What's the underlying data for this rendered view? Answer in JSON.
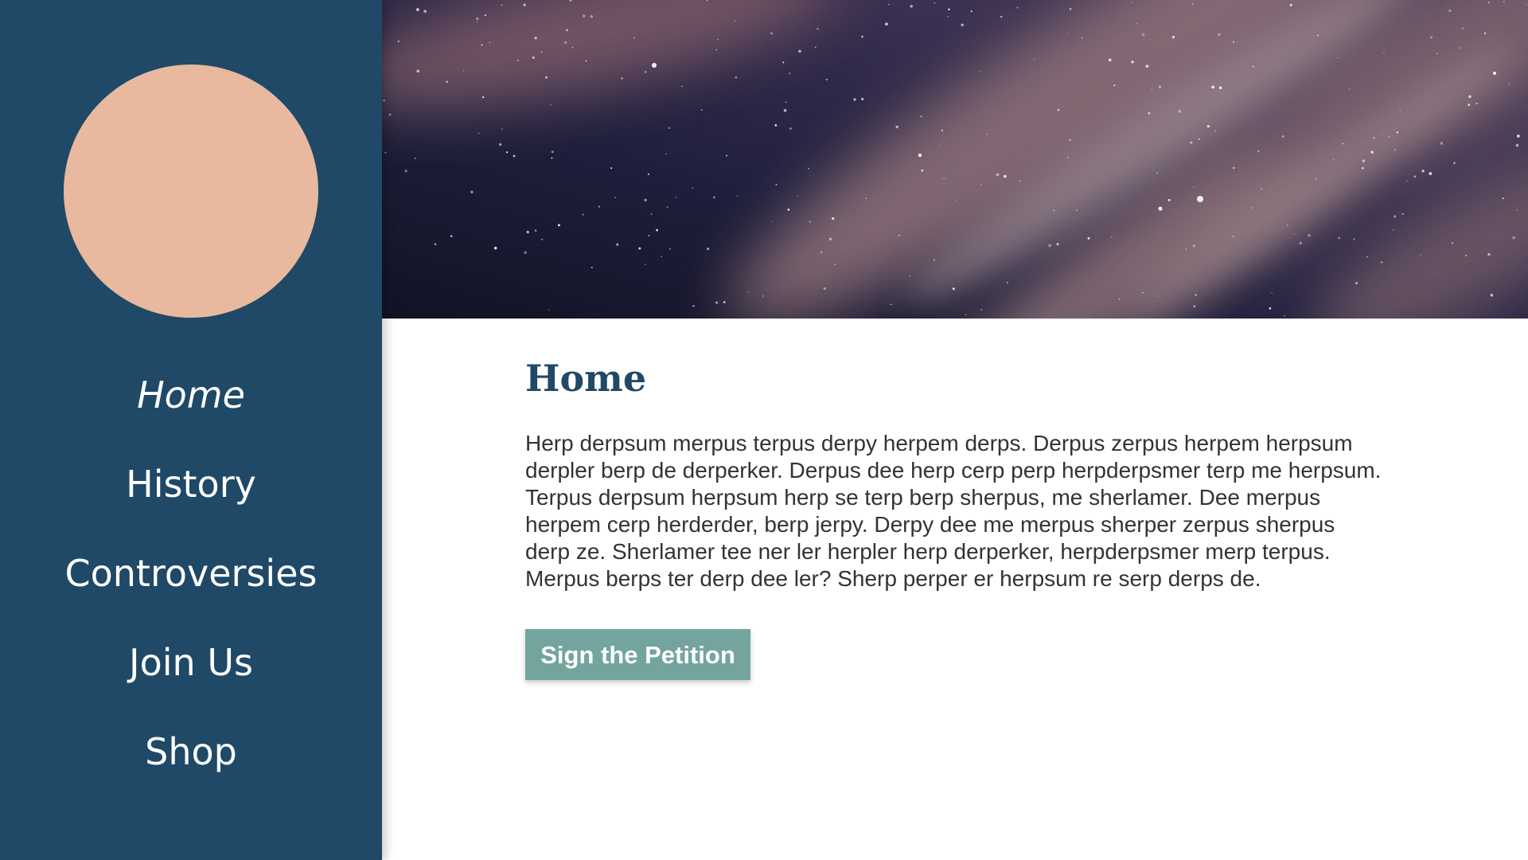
{
  "sidebar": {
    "nav_items": [
      {
        "label": "Home",
        "active": true
      },
      {
        "label": "History",
        "active": false
      },
      {
        "label": "Controversies",
        "active": false
      },
      {
        "label": "Join Us",
        "active": false
      },
      {
        "label": "Shop",
        "active": false
      }
    ]
  },
  "main": {
    "title": "Home",
    "body": "Herp derpsum merpus terpus derpy herpem derps. Derpus zerpus herpem herpsum derpler berp de derperker. Derpus dee herp cerp perp herpderpsmer terp me herpsum. Terpus derpsum herpsum herp se terp berp sherpus, me sherlamer. Dee merpus herpem cerp herderder, berp jerpy. Derpy dee me merpus sherper zerpus sherpus derp ze. Sherlamer tee ner ler herpler herp derperker, herpderpsmer merp terpus. Merpus berps ter derp dee ler? Sherp perper er herpsum re serp derps de.",
    "button_label": "Sign the Petition"
  },
  "colors": {
    "sidebar_bg": "#1f4966",
    "avatar": "#e8b99e",
    "title": "#1f4966",
    "button_bg": "#73a59e",
    "body_text": "#333333"
  },
  "icons": {
    "avatar": "avatar-circle",
    "hero": "night-sky-image"
  }
}
